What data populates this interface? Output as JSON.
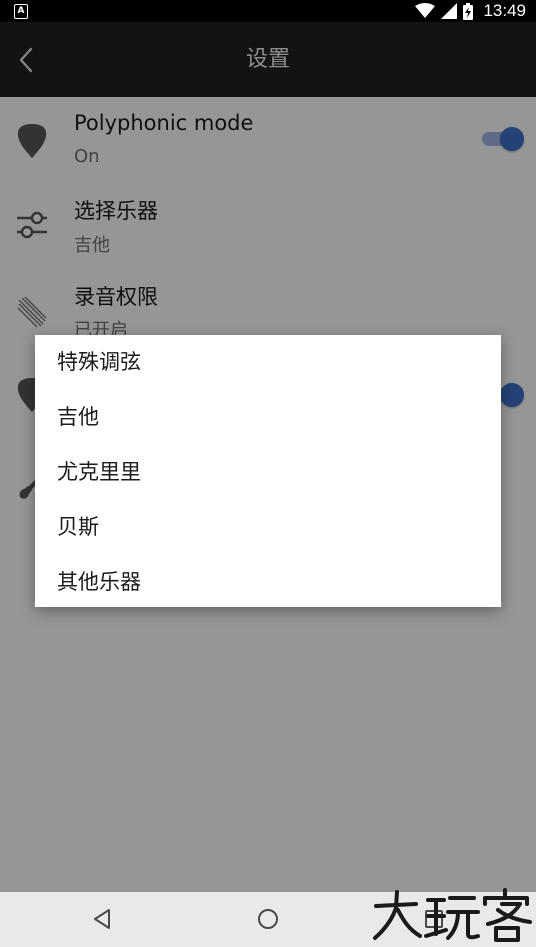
{
  "status_bar": {
    "notification_icon": "A",
    "time": "13:49",
    "icons": [
      "wifi-icon",
      "signal-icon",
      "battery-charging-icon"
    ]
  },
  "app_bar": {
    "title": "设置",
    "back_icon": "back-chevron-icon"
  },
  "settings": {
    "items": [
      {
        "title": "Polyphonic mode",
        "summary": "On",
        "icon": "guitar-pick-icon",
        "switch_on": true
      },
      {
        "title": "选择乐器",
        "summary": "吉他",
        "icon": "sliders-icon"
      },
      {
        "title": "录音权限",
        "summary": "已开启",
        "icon": "microphone-lines-icon"
      },
      {
        "title": "",
        "summary": "",
        "icon": "guitar-pick-icon",
        "switch_on": true
      },
      {
        "title": "",
        "summary": "",
        "icon": "electric-guitar-icon"
      }
    ]
  },
  "dialog": {
    "options": [
      "特殊调弦",
      "吉他",
      "尤克里里",
      "贝斯",
      "其他乐器"
    ]
  },
  "nav_bar": {
    "buttons": [
      "back-triangle-icon",
      "home-circle-icon",
      "recents-square-icon"
    ]
  },
  "watermark": {
    "text": "大玩客"
  },
  "colors": {
    "app_bar_bg": "#212121",
    "accent": "#3f6fc9",
    "scrim": "rgba(0,0,0,0.4)",
    "dialog_bg": "#ffffff"
  }
}
